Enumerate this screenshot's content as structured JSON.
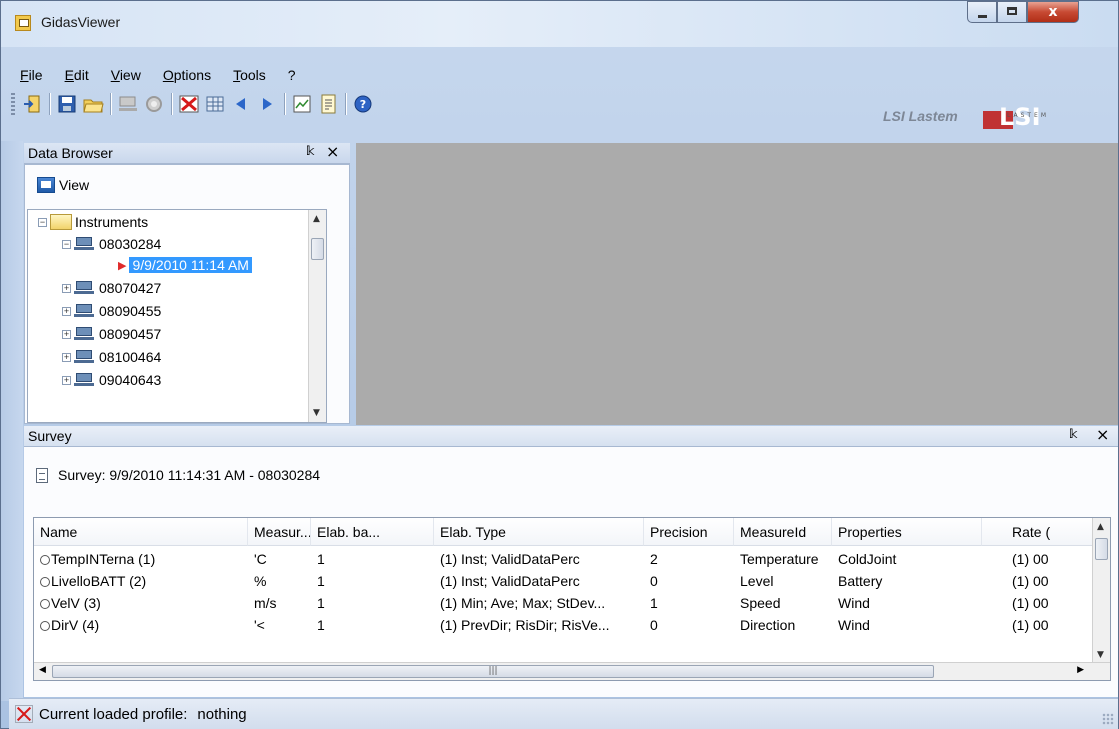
{
  "window": {
    "title": "GidasViewer"
  },
  "menu": [
    "File",
    "Edit",
    "View",
    "Options",
    "Tools",
    "?"
  ],
  "brand": {
    "text": "LSI Lastem",
    "logo_text": "LSI",
    "logo_sub": "LASTEM"
  },
  "data_browser": {
    "title": "Data Browser",
    "pin": "\u0001",
    "close": "×",
    "view_label": "View",
    "tree": {
      "root": "Instruments",
      "items": [
        {
          "label": "08030284",
          "expanded": true
        },
        {
          "label": "9/9/2010 11:14 AM",
          "selected": true
        },
        {
          "label": "08070427"
        },
        {
          "label": "08090455"
        },
        {
          "label": "08090457"
        },
        {
          "label": "08100464"
        },
        {
          "label": "09040643"
        }
      ]
    }
  },
  "survey": {
    "title": "Survey",
    "caption": "Survey: 9/9/2010 11:14:31 AM - 08030284",
    "columns": [
      "Name",
      "Measur...",
      "Elab. ba...",
      "Elab. Type",
      "Precision",
      "MeasureId",
      "Properties",
      "Rate ("
    ],
    "rows": [
      [
        "TempINTerna (1)",
        "'C",
        "1",
        "(1) Inst; ValidDataPerc",
        "2",
        "Temperature",
        "ColdJoint",
        "(1) 00"
      ],
      [
        "LivelloBATT (2)",
        "%",
        "1",
        "(1) Inst; ValidDataPerc",
        "0",
        "Level",
        "Battery",
        "(1) 00"
      ],
      [
        "VelV (3)",
        "m/s",
        "1",
        "(1) Min; Ave; Max; StDev...",
        "1",
        "Speed",
        "Wind",
        "(1) 00"
      ],
      [
        "DirV (4)",
        "'<",
        "1",
        "(1) PrevDir; RisDir; RisVe...",
        "0",
        "Direction",
        "Wind",
        "(1) 00"
      ]
    ]
  },
  "status": {
    "label": "Current loaded profile:",
    "value": "nothing"
  },
  "colors": {
    "selection": "#3399ff",
    "workarea": "#ababab",
    "close_red": "#c74a33"
  }
}
